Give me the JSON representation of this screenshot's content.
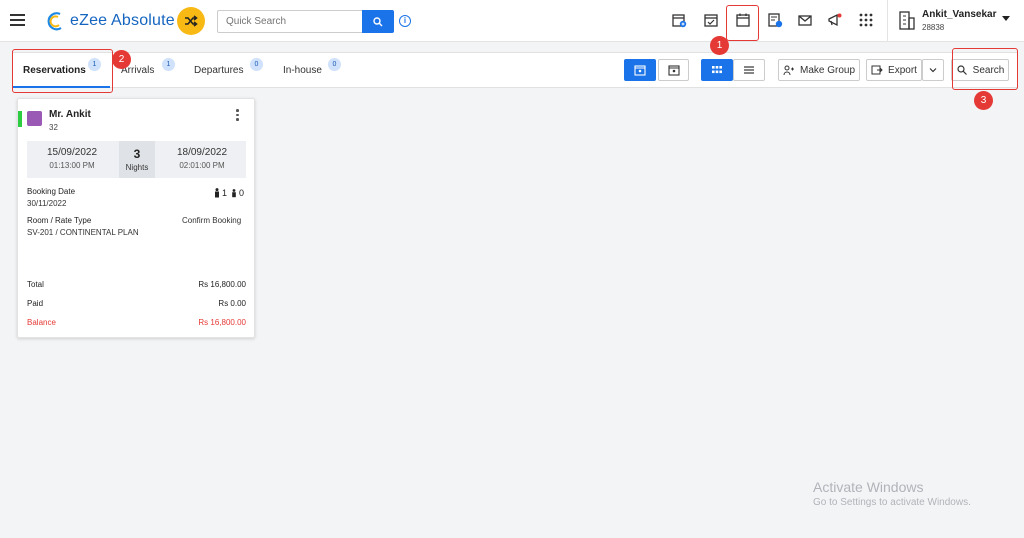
{
  "app": {
    "name": "eZee Absolute"
  },
  "header": {
    "search_placeholder": "Quick Search",
    "info_glyph": "i",
    "icons": [
      "calendar-plus-icon",
      "calendar-check-icon",
      "calendar-icon",
      "document-dollar-icon",
      "mail-icon",
      "megaphone-icon",
      "apps-grid-icon"
    ],
    "user": {
      "name": "Ankit_Vansekar",
      "code": "28838"
    }
  },
  "tabs": [
    {
      "label": "Reservations",
      "count": "1",
      "active": true
    },
    {
      "label": "Arrivals",
      "count": "1"
    },
    {
      "label": "Departures",
      "count": "0"
    },
    {
      "label": "In-house",
      "count": "0"
    }
  ],
  "toolbar": {
    "make_group_label": "Make Group",
    "export_label": "Export",
    "search_label": "Search"
  },
  "annotations": [
    "1",
    "2",
    "3"
  ],
  "card": {
    "guest_name": "Mr. Ankit",
    "guest_sub": "32",
    "checkin_date": "15/09/2022",
    "checkin_time": "01:13:00 PM",
    "nights": "3",
    "nights_label": "Nights",
    "checkout_date": "18/09/2022",
    "checkout_time": "02:01:00 PM",
    "booking_date_label": "Booking Date",
    "booking_date": "30/11/2022",
    "adults": "1",
    "children": "0",
    "room_rate_label": "Room / Rate Type",
    "booking_status": "Confirm Booking",
    "room_rate": "SV-201 / CONTINENTAL PLAN",
    "total_label": "Total",
    "total": "Rs 16,800.00",
    "paid_label": "Paid",
    "paid": "Rs 0.00",
    "balance_label": "Balance",
    "balance": "Rs 16,800.00"
  },
  "watermark": {
    "line1": "Activate Windows",
    "line2": "Go to Settings to activate Windows."
  },
  "colors": {
    "accent": "#1a73e8",
    "annotation": "#e53935",
    "shuffle": "#f9b915",
    "status_green": "#2ecc40"
  }
}
